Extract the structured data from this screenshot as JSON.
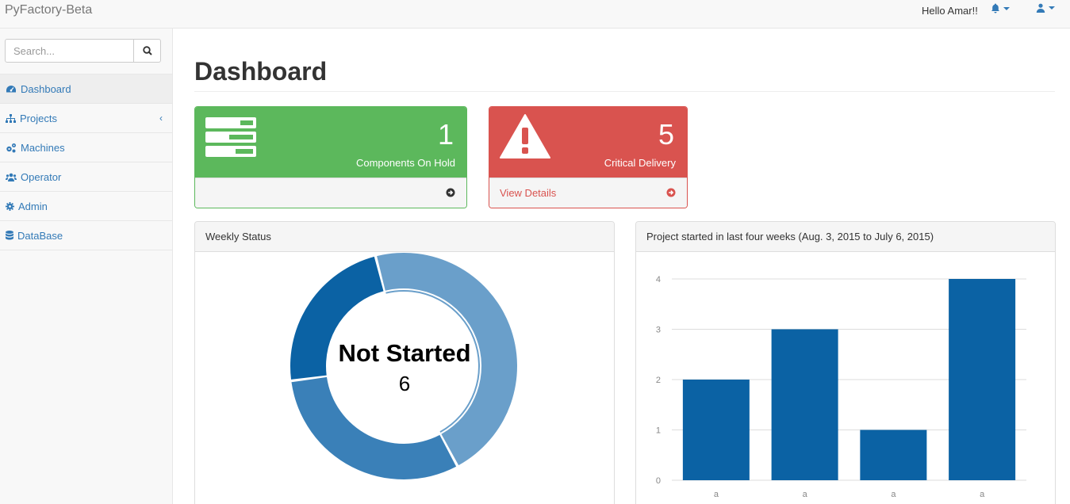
{
  "navbar": {
    "brand": "PyFactory-Beta",
    "greeting": "Hello Amar!!",
    "icons": [
      "bell-icon",
      "user-icon"
    ]
  },
  "sidebar": {
    "search_placeholder": "Search...",
    "items": [
      {
        "label": "Dashboard",
        "icon": "dashboard-icon",
        "active": true
      },
      {
        "label": "Projects",
        "icon": "sitemap-icon",
        "has_arrow": true
      },
      {
        "label": "Machines",
        "icon": "gears-icon"
      },
      {
        "label": "Operator",
        "icon": "users-icon"
      },
      {
        "label": "Admin",
        "icon": "gear-icon"
      },
      {
        "label": "DataBase",
        "icon": "database-icon"
      }
    ],
    "projects_arrow": "‹"
  },
  "page": {
    "title": "Dashboard"
  },
  "stats": [
    {
      "value": "1",
      "label": "Components On Hold",
      "link": "",
      "color": "#5cb85c",
      "icon": "tasks-icon"
    },
    {
      "value": "5",
      "label": "Critical Delivery",
      "link": "View Details",
      "color": "#d9534f",
      "icon": "warning-icon"
    }
  ],
  "weekly_panel": {
    "title": "Weekly Status",
    "center_label": "Not Started",
    "center_value": "6"
  },
  "projects_panel": {
    "title": "Project started in last four weeks (Aug. 3, 2015 to July 6, 2015)"
  },
  "chart_data": [
    {
      "type": "pie",
      "subtype": "donut",
      "segments": [
        {
          "value": 6,
          "color": "#6a9fca"
        },
        {
          "value": 4,
          "color": "#3a80b8"
        },
        {
          "value": 3,
          "color": "#0b62a4"
        }
      ],
      "center_label": "Not Started",
      "center_value": "6"
    },
    {
      "type": "bar",
      "categories": [
        "a",
        "a",
        "a",
        "a"
      ],
      "values": [
        2,
        3,
        1,
        4
      ],
      "ylim": [
        0,
        4
      ],
      "yticks": [
        0,
        1,
        2,
        3,
        4
      ],
      "grid": true,
      "color": "#0b62a4"
    }
  ]
}
